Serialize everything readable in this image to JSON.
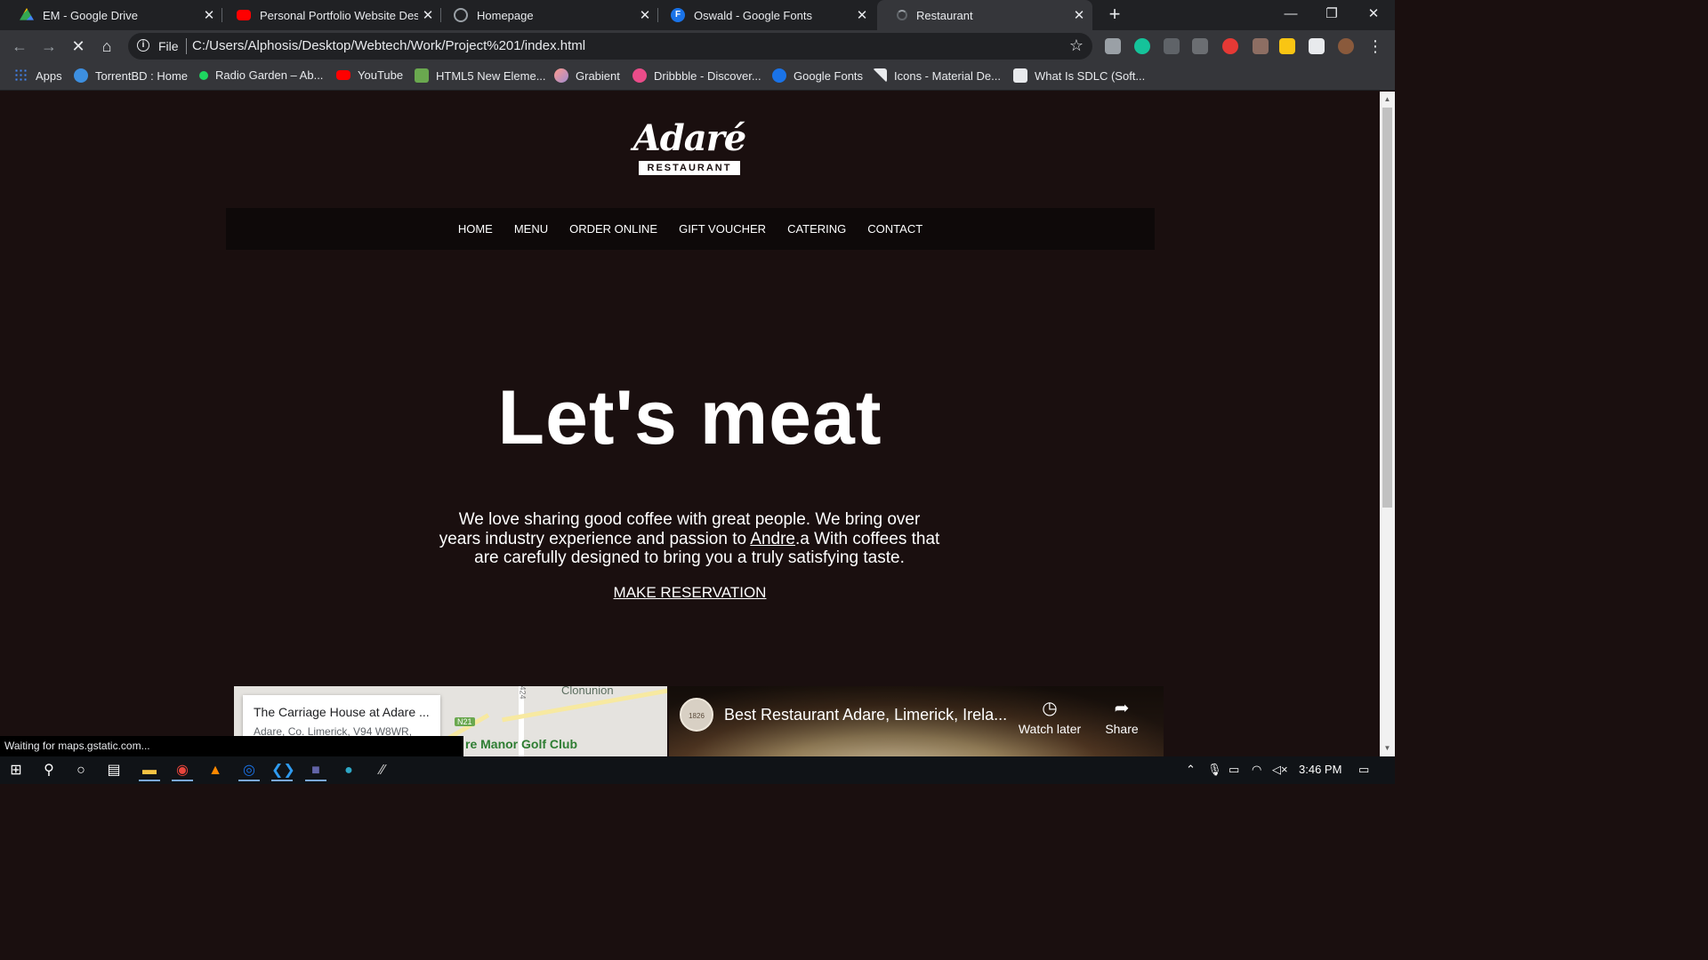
{
  "browser": {
    "tabs": [
      {
        "title": "EM - Google Drive",
        "icon": "google-drive-icon",
        "color": "#34a853"
      },
      {
        "title": "Personal Portfolio Website Design",
        "icon": "youtube-icon",
        "color": "#ff0000"
      },
      {
        "title": "Homepage",
        "icon": "globe-icon",
        "color": "#9aa0a6"
      },
      {
        "title": "Oswald - Google Fonts",
        "icon": "google-fonts-icon",
        "color": "#1a73e8"
      },
      {
        "title": "Restaurant",
        "icon": "loading-icon",
        "color": "#9aa0a6",
        "active": true
      }
    ],
    "new_tab": "+",
    "address": {
      "scheme_label": "File",
      "url": "C:/Users/Alphosis/Desktop/Webtech/Work/Project%201/index.html"
    },
    "bookmarks": [
      {
        "label": "Apps",
        "icon": "apps-grid-icon",
        "color": "#4285f4"
      },
      {
        "label": "TorrentBD : Home",
        "icon": "torrentbd-icon",
        "color": "#3d8fe0"
      },
      {
        "label": "Radio Garden – Ab...",
        "icon": "radio-garden-icon",
        "color": "#1ed760"
      },
      {
        "label": "YouTube",
        "icon": "youtube-icon",
        "color": "#ff0000"
      },
      {
        "label": "HTML5 New Eleme...",
        "icon": "html5-icon",
        "color": "#6aa84f"
      },
      {
        "label": "Grabient",
        "icon": "grabient-icon",
        "color": "#c77dff"
      },
      {
        "label": "Dribbble - Discover...",
        "icon": "dribbble-icon",
        "color": "#ea4c89"
      },
      {
        "label": "Google Fonts",
        "icon": "google-fonts-icon",
        "color": "#1a73e8"
      },
      {
        "label": "Icons - Material De...",
        "icon": "material-icon",
        "color": "#e8eaed"
      },
      {
        "label": "What Is SDLC (Soft...",
        "icon": "sdlc-icon",
        "color": "#e8eaed"
      }
    ],
    "status_text": "Waiting for maps.gstatic.com..."
  },
  "page": {
    "logo_script": "Adaré",
    "logo_sub": "RESTAURANT",
    "nav": [
      "HOME",
      "MENU",
      "ORDER ONLINE",
      "GIFT VOUCHER",
      "CATERING",
      "CONTACT"
    ],
    "hero_title": "Let's meat",
    "hero_text_before": "We love sharing good coffee with great people. We bring over years industry experience and passion to ",
    "hero_text_link": "Andre",
    "hero_text_after": ".a With coffees that are carefully designed to bring you a truly satisfying taste.",
    "reservation": "MAKE RESERVATION",
    "map": {
      "place_title": "The Carriage House at Adare ...",
      "place_address": "Adare, Co. Limerick, V94 W8WR,",
      "label_town": "Clonunion",
      "label_road": "N21",
      "label_route": "424",
      "label_golf": "re Manor Golf Club"
    },
    "video": {
      "title": "Best Restaurant Adare, Limerick, Irela...",
      "channel_badge": "1826",
      "watch_later": "Watch later",
      "share": "Share"
    }
  },
  "taskbar": {
    "time": "3:46 PM"
  }
}
